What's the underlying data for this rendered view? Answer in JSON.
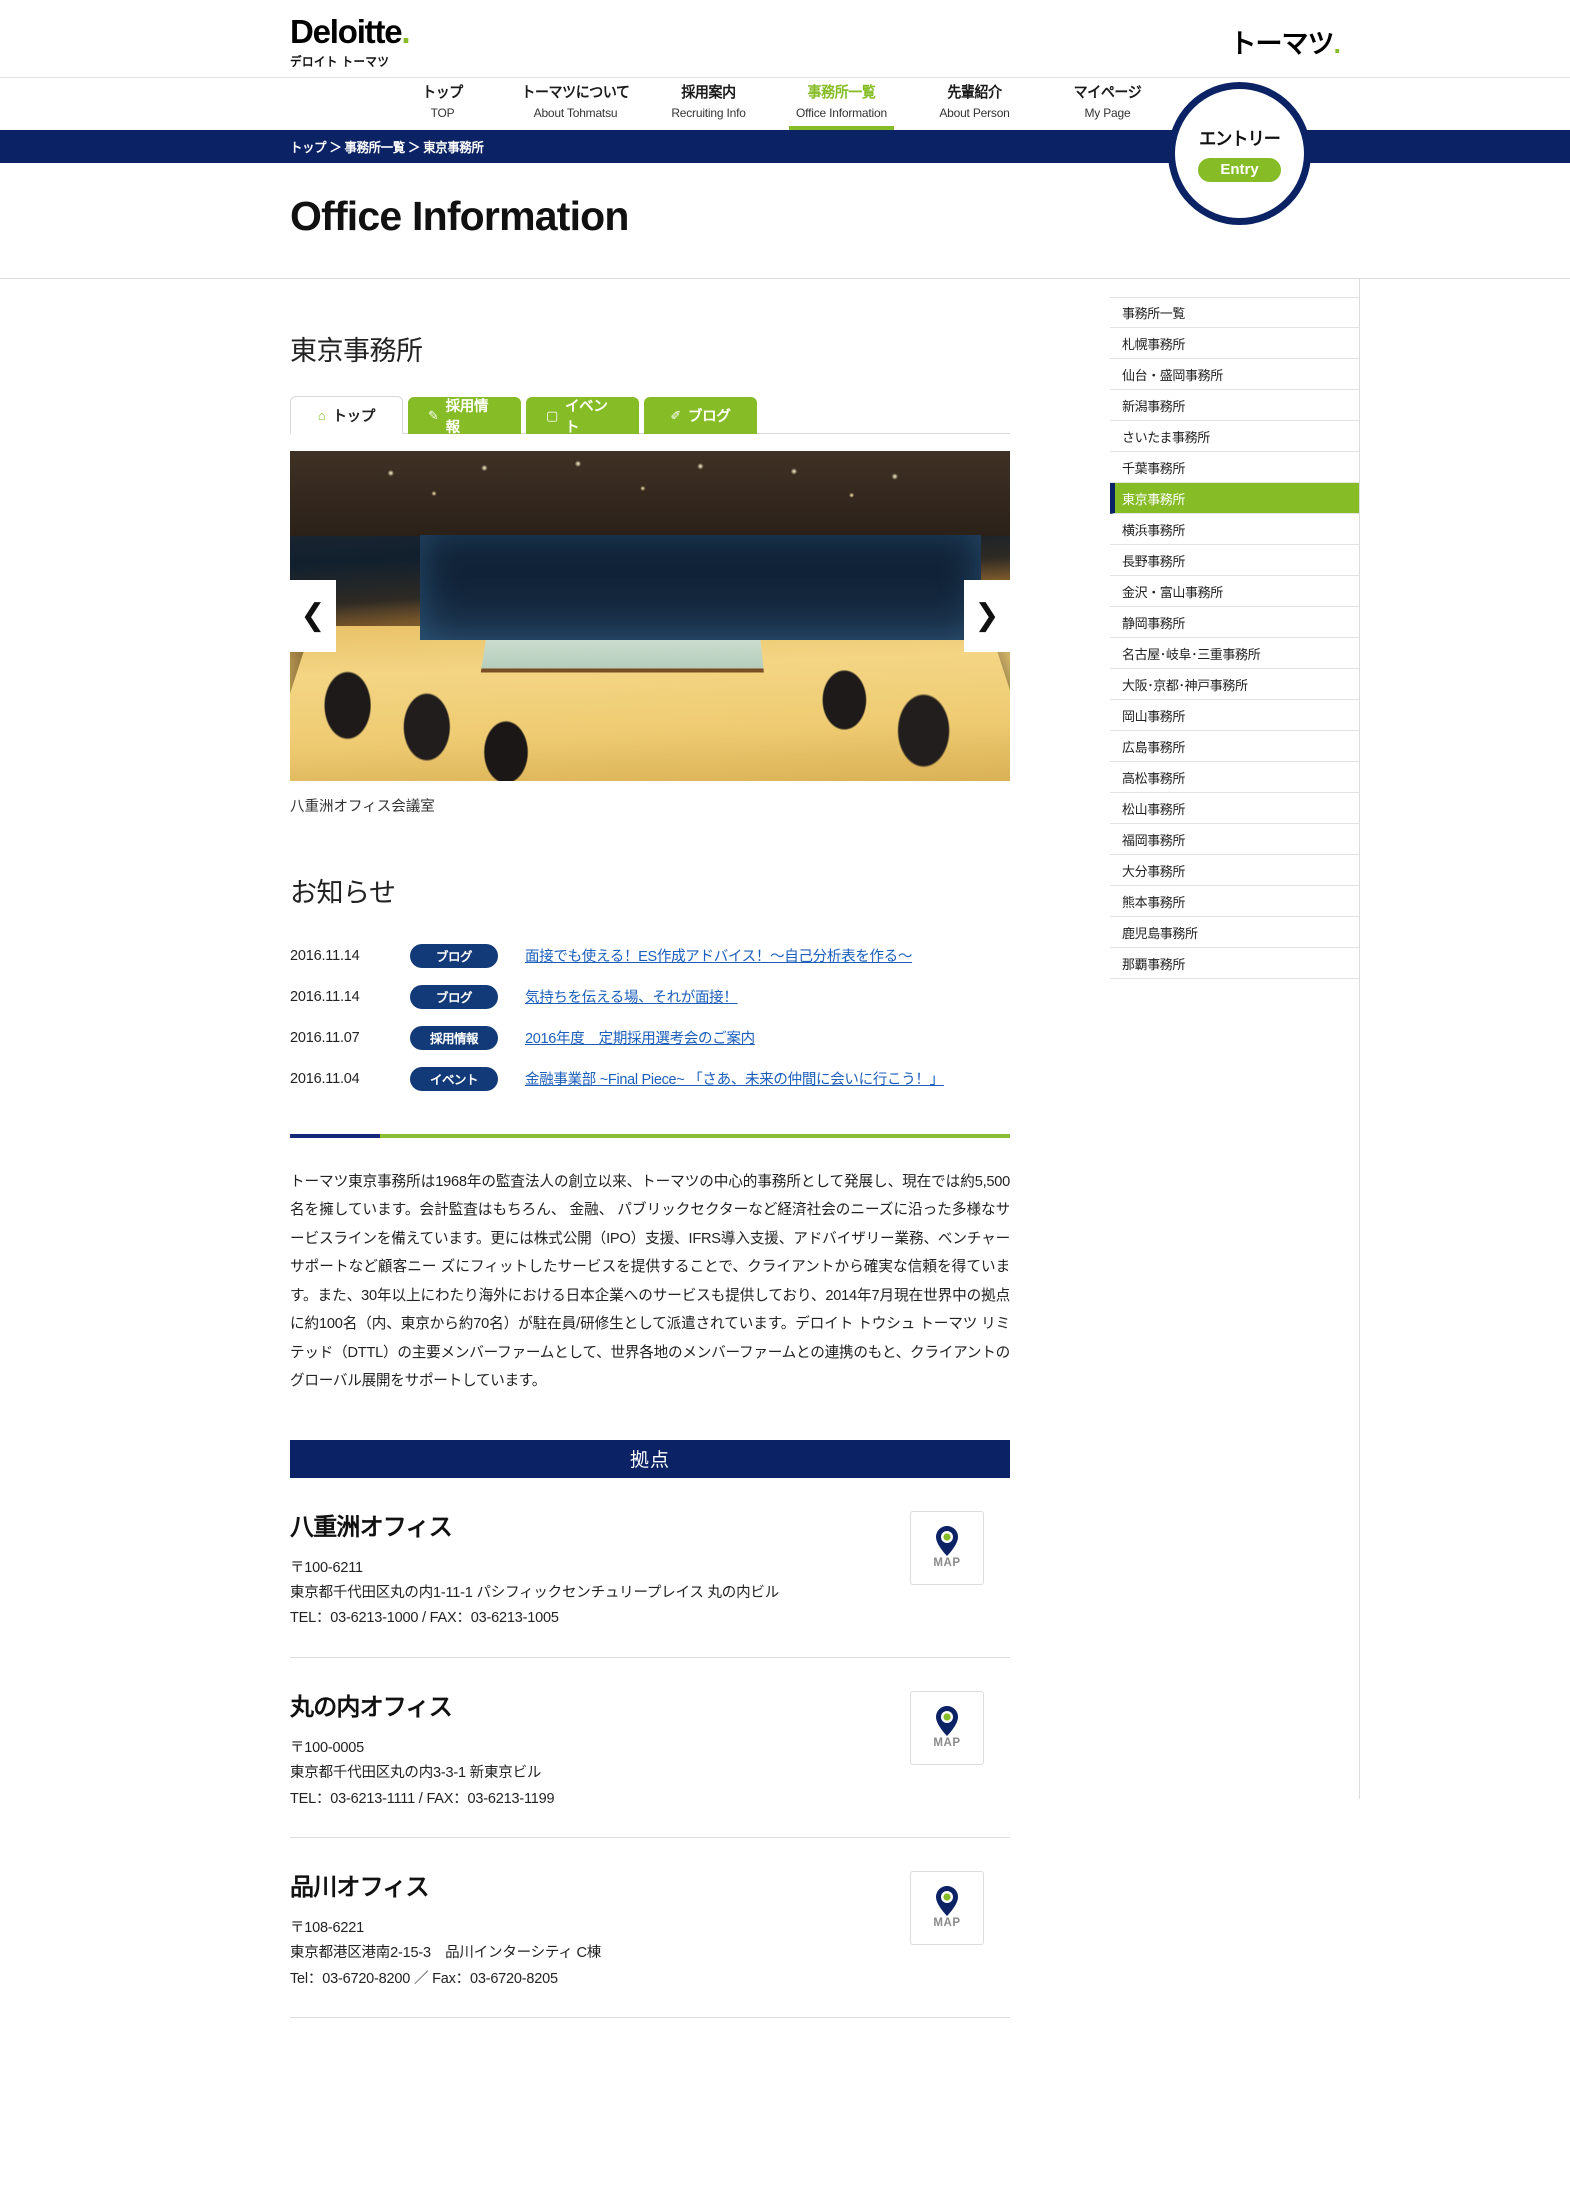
{
  "header": {
    "logo_main": "Deloitte",
    "logo_dot": ".",
    "logo_sub": "デロイト トーマツ",
    "logo_right": "トーマツ",
    "logo_right_dot": "."
  },
  "gnav": {
    "items": [
      {
        "ja": "トップ",
        "en": "TOP",
        "active": false
      },
      {
        "ja": "トーマツについて",
        "en": "About Tohmatsu",
        "active": false
      },
      {
        "ja": "採用案内",
        "en": "Recruiting Info",
        "active": false
      },
      {
        "ja": "事務所一覧",
        "en": "Office Information",
        "active": true
      },
      {
        "ja": "先輩紹介",
        "en": "About Person",
        "active": false
      },
      {
        "ja": "マイページ",
        "en": "My Page",
        "active": false
      }
    ]
  },
  "entry": {
    "ja": "エントリー",
    "en": "Entry"
  },
  "breadcrumb": "トップ ＞ 事務所一覧 ＞ 東京事務所",
  "page_title": "Office Information",
  "office_name": "東京事務所",
  "tabs": [
    {
      "icon": "home-icon",
      "glyph": "⌂",
      "label": "トップ",
      "active": true
    },
    {
      "icon": "pencil-square-icon",
      "glyph": "✎",
      "label": "採用情報",
      "active": false
    },
    {
      "icon": "calendar-icon",
      "glyph": "▢",
      "label": "イベント",
      "active": false
    },
    {
      "icon": "pen-icon",
      "glyph": "✐",
      "label": "ブログ",
      "active": false
    }
  ],
  "carousel": {
    "prev_label": "❮",
    "next_label": "❯",
    "caption": "八重洲オフィス会議室"
  },
  "news": {
    "heading": "お知らせ",
    "items": [
      {
        "date": "2016.11.14",
        "badge": "ブログ",
        "title": "面接でも使える！ES作成アドバイス！〜自己分析表を作る〜"
      },
      {
        "date": "2016.11.14",
        "badge": "ブログ",
        "title": "気持ちを伝える場、それが面接！"
      },
      {
        "date": "2016.11.07",
        "badge": "採用情報",
        "title": "2016年度　定期採用選考会のご案内"
      },
      {
        "date": "2016.11.04",
        "badge": "イベント",
        "title": "金融事業部 ~Final Piece~ 「さあ、未来の仲間に会いに行こう！」"
      }
    ]
  },
  "description": "トーマツ東京事務所は1968年の監査法人の創立以来、トーマツの中心的事務所として発展し、現在では約5,500名を擁しています。会計監査はもちろん、 金融、 パブリックセクターなど経済社会のニーズに沿った多様なサービスラインを備えています。更には株式公開（IPO）支援、IFRS導入支援、アドバイザリー業務、ベンチャーサポートなど顧客ニー ズにフィットしたサービスを提供することで、クライアントから確実な信頼を得ています。また、30年以上にわたり海外における日本企業へのサービスも提供しており、2014年7月現在世界中の拠点に約100名（内、東京から約70名）が駐在員/研修生として派遣されています。デロイト トウシュ トーマツ リミテッド（DTTL）の主要メンバーファームとして、世界各地のメンバーファームとの連携のもと、クライアントのグローバル展開をサポートしています。",
  "locations_heading": "拠点",
  "offices": [
    {
      "name": "八重洲オフィス",
      "postal": "〒100-6211",
      "address": "東京都千代田区丸の内1-11-1 パシフィックセンチュリープレイス 丸の内ビル",
      "contact": "TEL：03-6213-1000 / FAX：03-6213-1005",
      "map_label": "MAP"
    },
    {
      "name": "丸の内オフィス",
      "postal": "〒100-0005",
      "address": "東京都千代田区丸の内3-3-1 新東京ビル",
      "contact": "TEL：03-6213-1111 / FAX：03-6213-1199",
      "map_label": "MAP"
    },
    {
      "name": "品川オフィス",
      "postal": "〒108-6221",
      "address": "東京都港区港南2-15-3　品川インターシティ C棟",
      "contact": "Tel：03-6720-8200 ／ Fax：03-6720-8205",
      "map_label": "MAP"
    }
  ],
  "sidebar": {
    "items": [
      {
        "label": "事務所一覧",
        "active": false
      },
      {
        "label": "札幌事務所",
        "active": false
      },
      {
        "label": "仙台・盛岡事務所",
        "active": false
      },
      {
        "label": "新潟事務所",
        "active": false
      },
      {
        "label": "さいたま事務所",
        "active": false
      },
      {
        "label": "千葉事務所",
        "active": false
      },
      {
        "label": "東京事務所",
        "active": true
      },
      {
        "label": "横浜事務所",
        "active": false
      },
      {
        "label": "長野事務所",
        "active": false
      },
      {
        "label": "金沢・富山事務所",
        "active": false
      },
      {
        "label": "静岡事務所",
        "active": false
      },
      {
        "label": "名古屋･岐阜･三重事務所",
        "active": false
      },
      {
        "label": "大阪･京都･神戸事務所",
        "active": false
      },
      {
        "label": "岡山事務所",
        "active": false
      },
      {
        "label": "広島事務所",
        "active": false
      },
      {
        "label": "高松事務所",
        "active": false
      },
      {
        "label": "松山事務所",
        "active": false
      },
      {
        "label": "福岡事務所",
        "active": false
      },
      {
        "label": "大分事務所",
        "active": false
      },
      {
        "label": "熊本事務所",
        "active": false
      },
      {
        "label": "鹿児島事務所",
        "active": false
      },
      {
        "label": "那覇事務所",
        "active": false
      }
    ]
  },
  "colors": {
    "navy": "#0b2265",
    "green": "#86bc25",
    "badge_navy": "#123a78",
    "link_blue": "#1c5fbb"
  }
}
